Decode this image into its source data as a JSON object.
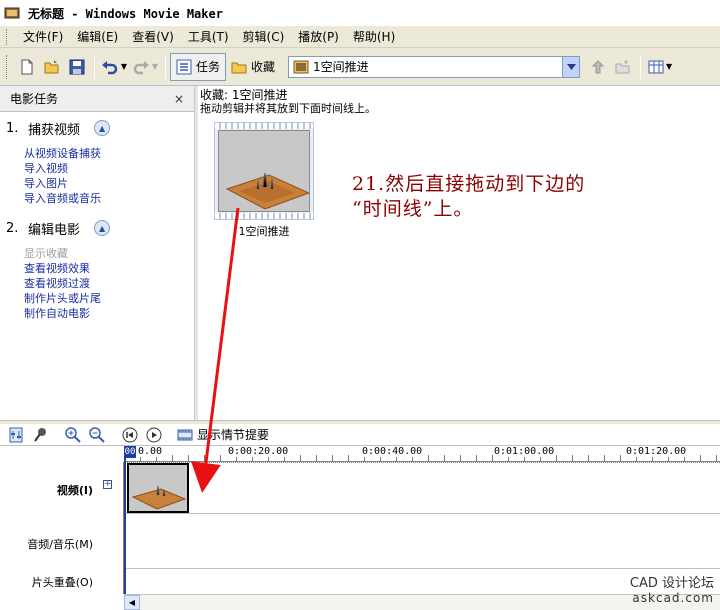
{
  "window": {
    "title": "无标题 - Windows Movie Maker"
  },
  "menu": {
    "items": [
      "文件(F)",
      "编辑(E)",
      "查看(V)",
      "工具(T)",
      "剪辑(C)",
      "播放(P)",
      "帮助(H)"
    ]
  },
  "toolbar": {
    "tasks_label": "任务",
    "collections_label": "收藏",
    "collection_selected": "1空间推进"
  },
  "taskpane": {
    "title": "电影任务",
    "close_glyph": "×",
    "sections": [
      {
        "number": "1.",
        "title": "捕获视频",
        "links": [
          "从视频设备捕获",
          "导入视频",
          "导入图片",
          "导入音频或音乐"
        ]
      },
      {
        "number": "2.",
        "title": "编辑电影",
        "links": [
          "显示收藏",
          "查看视频效果",
          "查看视频过渡",
          "制作片头或片尾",
          "制作自动电影"
        ]
      }
    ]
  },
  "collection": {
    "title": "收藏: 1空间推进",
    "hint": "拖动剪辑并将其放到下面时间线上。",
    "clip_label": "1空间推进"
  },
  "annotation": {
    "line1": "21.然后直接拖动到下边的",
    "line2": "“时间线”上。",
    "color": "#8b0000"
  },
  "timeline": {
    "storyboard_label": "显示情节提要",
    "ruler": [
      "0.00",
      "0:00:20.00",
      "0:00:40.00",
      "0:01:00.00",
      "0:01:20.00"
    ],
    "playhead_label": "00",
    "tracks": [
      "视频(I)",
      "音频/音乐(M)",
      "片头重叠(O)"
    ]
  },
  "watermark": {
    "line1": "CAD 设计论坛",
    "line2": "askcad.com"
  }
}
